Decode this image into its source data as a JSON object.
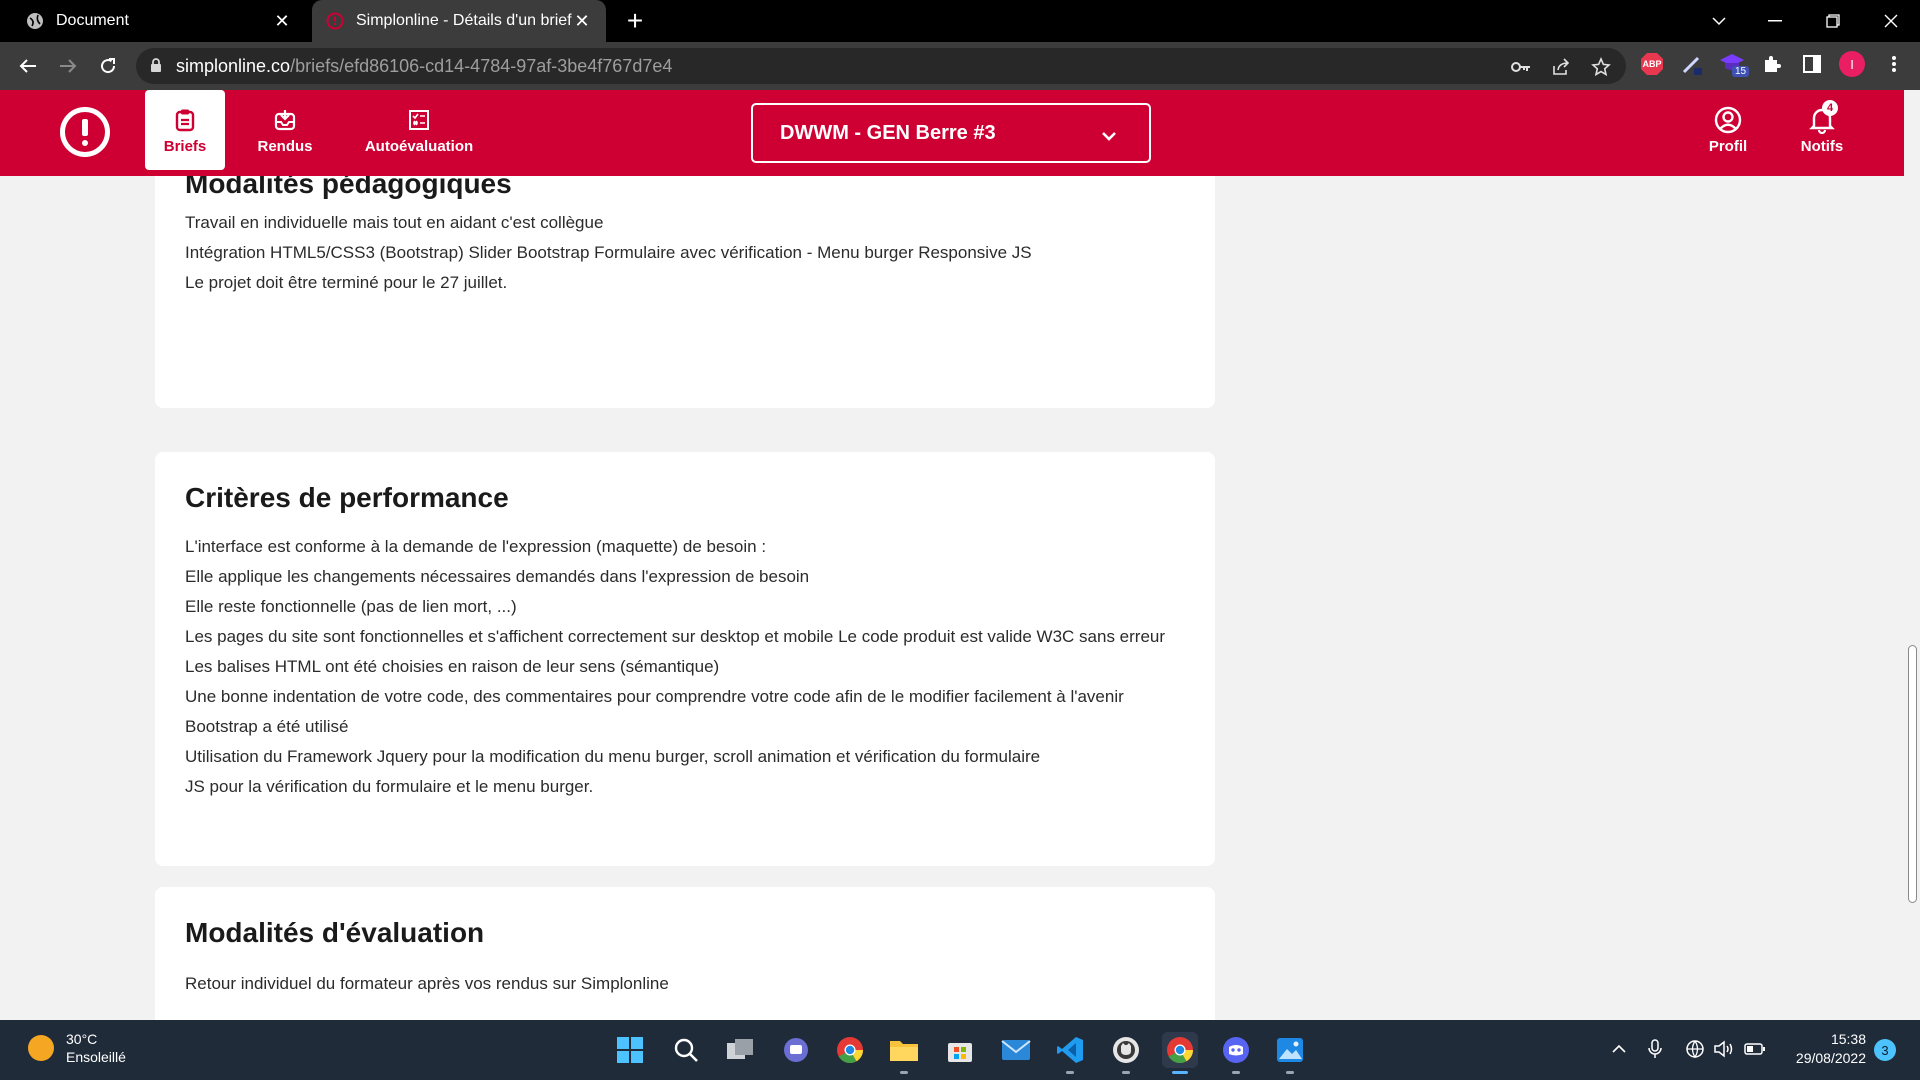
{
  "browser": {
    "tabs": [
      {
        "title": "Document",
        "active": false,
        "icon": "globe-icon"
      },
      {
        "title": "Simplonline - Détails d'un brief",
        "active": true,
        "icon": "simplon-icon"
      }
    ],
    "url_host": "simplonline.co",
    "url_path": "/briefs/efd86106-cd14-4784-97af-3be4f767d7e4",
    "ext_badge": "15",
    "profile_initial": "I",
    "abp_label": "ABP"
  },
  "header": {
    "nav": [
      {
        "label": "Briefs",
        "icon": "clipboard-icon",
        "active": true
      },
      {
        "label": "Rendus",
        "icon": "inbox-icon",
        "active": false
      },
      {
        "label": "Autoévaluation",
        "icon": "checklist-icon",
        "active": false
      }
    ],
    "promo_select": "DWWM - GEN Berre #3",
    "profile_label": "Profil",
    "notifs_label": "Notifs",
    "notifs_count": "4",
    "brand_color": "#ce0033"
  },
  "sections": {
    "modalites_pedagogiques": {
      "title": "Modalités pédagogiques",
      "lines": [
        "Travail en individuelle mais tout en aidant c'est collègue",
        "Intégration HTML5/CSS3 (Bootstrap) Slider Bootstrap Formulaire avec vérification - Menu burger Responsive JS",
        "Le projet doit être terminé pour le 27 juillet."
      ]
    },
    "criteres_performance": {
      "title": "Critères de performance",
      "lines": [
        "L'interface est conforme à la demande de l'expression (maquette) de besoin :",
        "Elle applique les changements nécessaires demandés dans l'expression de besoin",
        "Elle reste fonctionnelle (pas de lien mort, ...)",
        "Les pages du site sont fonctionnelles et s'affichent correctement sur desktop et mobile Le code produit est valide W3C sans erreur",
        "Les balises HTML ont été choisies en raison de leur sens (sémantique)",
        "Une bonne indentation de votre code, des commentaires pour comprendre votre code afin de le modifier facilement à l'avenir",
        "Bootstrap a été utilisé",
        "Utilisation du Framework Jquery pour la modification du menu burger, scroll animation et vérification du formulaire",
        "JS pour la vérification du formulaire et le menu burger."
      ]
    },
    "modalites_evaluation": {
      "title": "Modalités d'évaluation",
      "lines": [
        "Retour individuel du formateur après vos rendus sur Simplonline"
      ]
    }
  },
  "taskbar": {
    "weather_temp": "30°C",
    "weather_desc": "Ensoleillé",
    "time": "15:38",
    "date": "29/08/2022",
    "notification_count": "3"
  }
}
